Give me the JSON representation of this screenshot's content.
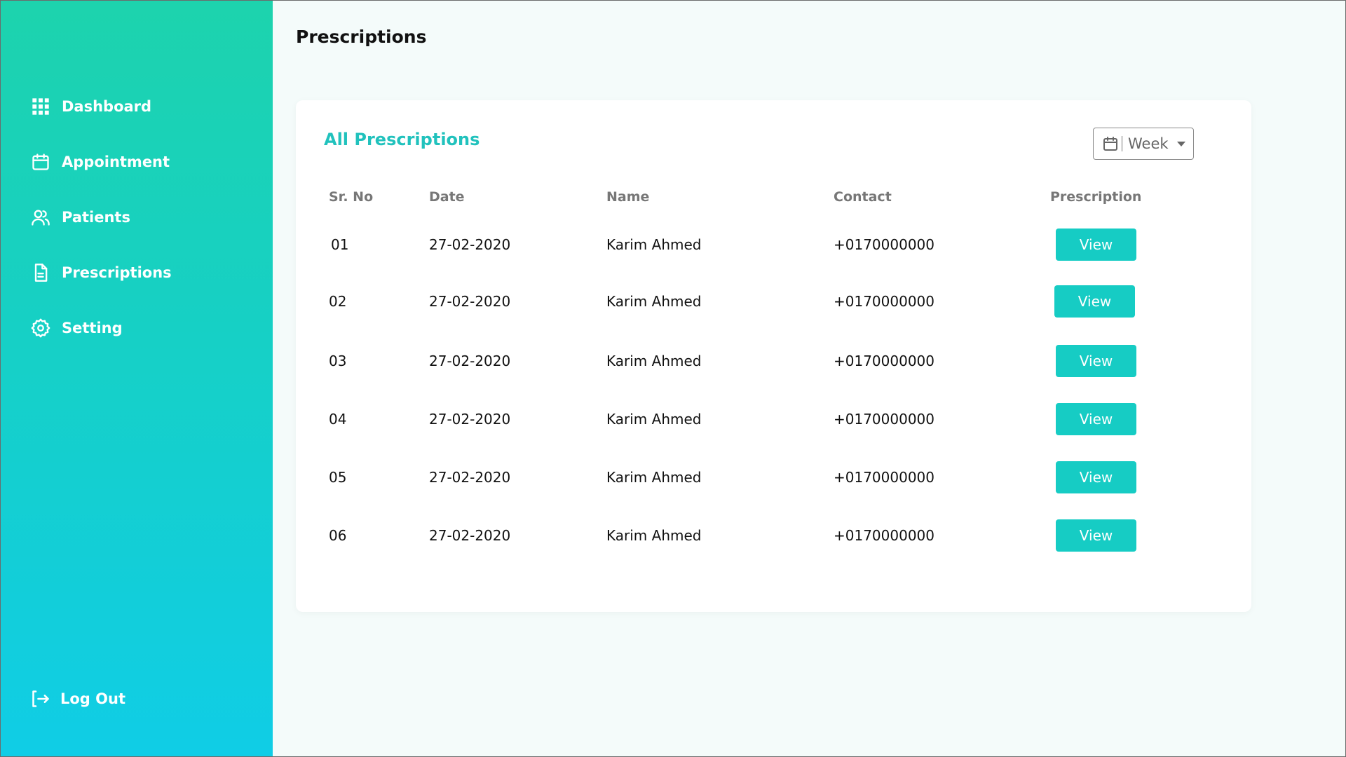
{
  "sidebar": {
    "items": [
      {
        "label": "Dashboard",
        "icon": "grid-icon"
      },
      {
        "label": "Appointment",
        "icon": "calendar-icon"
      },
      {
        "label": "Patients",
        "icon": "users-icon"
      },
      {
        "label": "Prescriptions",
        "icon": "document-icon"
      },
      {
        "label": "Setting",
        "icon": "gear-icon"
      }
    ],
    "logout": {
      "label": "Log Out",
      "icon": "logout-icon"
    }
  },
  "header": {
    "title": "Prescriptions"
  },
  "card": {
    "title": "All Prescriptions",
    "filter": {
      "value": "Week",
      "icon": "calendar-icon"
    },
    "columns": [
      "Sr. No",
      "Date",
      "Name",
      "Contact",
      "Prescription"
    ],
    "rows": [
      {
        "sr": "01",
        "date": "27-02-2020",
        "name": "Karim Ahmed",
        "contact": "+0170000000",
        "action": "View"
      },
      {
        "sr": "02",
        "date": "27-02-2020",
        "name": "Karim Ahmed",
        "contact": "+0170000000",
        "action": "View"
      },
      {
        "sr": "03",
        "date": "27-02-2020",
        "name": "Karim Ahmed",
        "contact": "+0170000000",
        "action": "View"
      },
      {
        "sr": "04",
        "date": "27-02-2020",
        "name": "Karim Ahmed",
        "contact": "+0170000000",
        "action": "View"
      },
      {
        "sr": "05",
        "date": "27-02-2020",
        "name": "Karim Ahmed",
        "contact": "+0170000000",
        "action": "View"
      },
      {
        "sr": "06",
        "date": "27-02-2020",
        "name": "Karim Ahmed",
        "contact": "+0170000000",
        "action": "View"
      }
    ]
  },
  "colors": {
    "sidebar_top": "#1dd3ad",
    "sidebar_bottom": "#10cde6",
    "accent": "#16ccc4",
    "card_title": "#21c2bd",
    "page_bg": "#f4fbfa"
  }
}
